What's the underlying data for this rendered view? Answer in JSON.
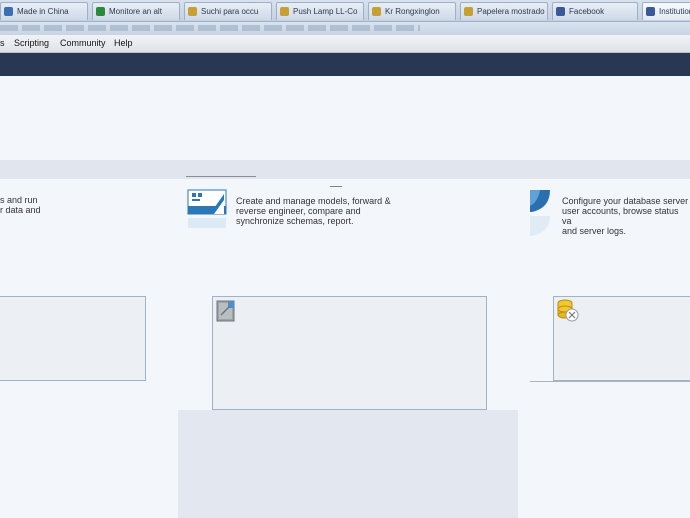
{
  "tabs": [
    {
      "label": "Made in China",
      "color": "#3b6fb5"
    },
    {
      "label": "Monitore an alt",
      "color": "#2a8a3a"
    },
    {
      "label": "Suchi para occu",
      "color": "#c8a032"
    },
    {
      "label": "Push Lamp LL-Co",
      "color": "#c8a032"
    },
    {
      "label": "Kr Rongxinglon",
      "color": "#c8a032"
    },
    {
      "label": "Papelera mostrado",
      "color": "#c8a032"
    },
    {
      "label": "Facebook",
      "color": "#3b5998"
    },
    {
      "label": "Institution",
      "color": "#3b5998"
    }
  ],
  "menubar": {
    "items": [
      "s",
      "Scripting",
      "Community",
      "Help"
    ]
  },
  "sections": {
    "left": {
      "lines": [
        "s and run",
        "r data and"
      ]
    },
    "center": {
      "lines": [
        "Create and manage models, forward &",
        "reverse engineer, compare and",
        "synchronize schemas, report."
      ]
    },
    "right": {
      "lines": [
        "Configure your database server",
        "user accounts, browse status va",
        "and server logs."
      ]
    }
  },
  "colors": {
    "dark_bar": "#283852",
    "card_border": "#9fb3c8"
  }
}
